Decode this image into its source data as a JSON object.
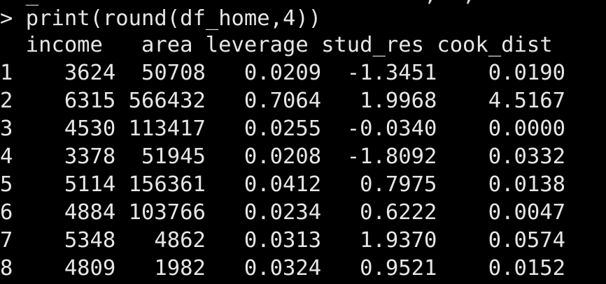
{
  "console": {
    "cut_off_text": "  _                              ,  ,              , ,   ,  (",
    "prompt_symbol": ">",
    "command": "print(round(df_home,4))",
    "header_text": "  income   area leverage stud_res cook_dist",
    "columns": [
      "income",
      "area",
      "leverage",
      "stud_res",
      "cook_dist"
    ],
    "rows": [
      {
        "index": "1",
        "income": "3624",
        "area": "50708",
        "leverage": "0.0209",
        "stud_res": "-1.3451",
        "cook_dist": "0.0190",
        "text": "1    3624  50708   0.0209  -1.3451    0.0190"
      },
      {
        "index": "2",
        "income": "6315",
        "area": "566432",
        "leverage": "0.7064",
        "stud_res": "1.9968",
        "cook_dist": "4.5167",
        "text": "2    6315 566432   0.7064   1.9968    4.5167"
      },
      {
        "index": "3",
        "income": "4530",
        "area": "113417",
        "leverage": "0.0255",
        "stud_res": "-0.0340",
        "cook_dist": "0.0000",
        "text": "3    4530 113417   0.0255  -0.0340    0.0000"
      },
      {
        "index": "4",
        "income": "3378",
        "area": "51945",
        "leverage": "0.0208",
        "stud_res": "-1.8092",
        "cook_dist": "0.0332",
        "text": "4    3378  51945   0.0208  -1.8092    0.0332"
      },
      {
        "index": "5",
        "income": "5114",
        "area": "156361",
        "leverage": "0.0412",
        "stud_res": "0.7975",
        "cook_dist": "0.0138",
        "text": "5    5114 156361   0.0412   0.7975    0.0138"
      },
      {
        "index": "6",
        "income": "4884",
        "area": "103766",
        "leverage": "0.0234",
        "stud_res": "0.6222",
        "cook_dist": "0.0047",
        "text": "6    4884 103766   0.0234   0.6222    0.0047"
      },
      {
        "index": "7",
        "income": "5348",
        "area": "4862",
        "leverage": "0.0313",
        "stud_res": "1.9370",
        "cook_dist": "0.0574",
        "text": "7    5348   4862   0.0313   1.9370    0.0574"
      },
      {
        "index": "8",
        "income": "4809",
        "area": "1982",
        "leverage": "0.0324",
        "stud_res": "0.9521",
        "cook_dist": "0.0152",
        "text": "8    4809   1982   0.0324   0.9521    0.0152"
      }
    ]
  },
  "colors": {
    "background": "#000000",
    "text": "#e6e6e6"
  }
}
